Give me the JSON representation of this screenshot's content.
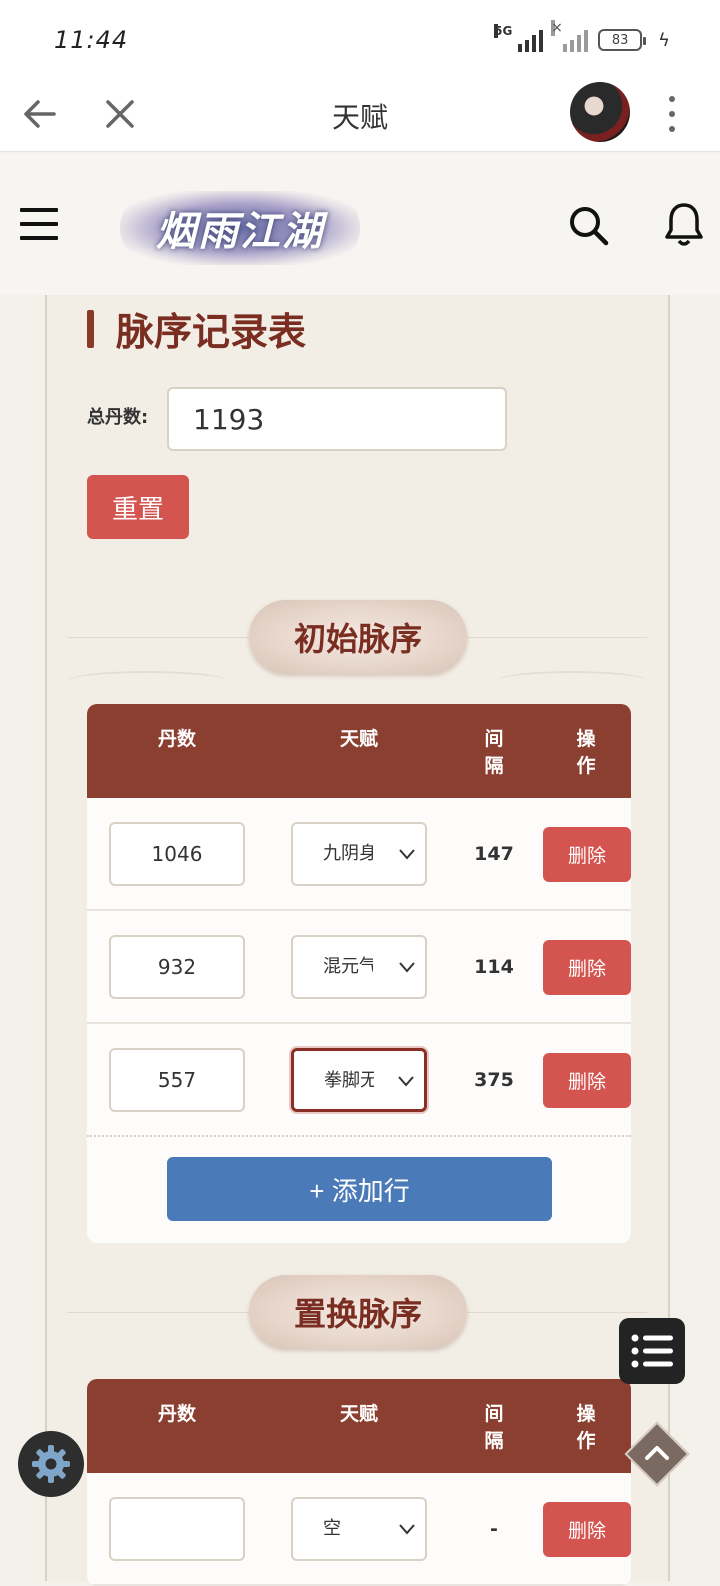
{
  "status_bar": {
    "time": "11:44",
    "network": "5G",
    "battery": "83"
  },
  "title_bar": {
    "title": "天赋"
  },
  "site_header": {
    "logo_text": "烟雨江湖"
  },
  "page": {
    "heading": "脉序记录表",
    "total_label": "总丹数:",
    "total_value": "1193",
    "reset_label": "重置"
  },
  "initial_section": {
    "title": "初始脉序",
    "headers": {
      "dan": "丹数",
      "tianfu": "天赋",
      "gap": "间隔",
      "action": "操作"
    },
    "rows": [
      {
        "dan": "1046",
        "tianfu": "九阴身",
        "gap": "147",
        "delete": "删除"
      },
      {
        "dan": "932",
        "tianfu": "混元气",
        "gap": "114",
        "delete": "删除"
      },
      {
        "dan": "557",
        "tianfu": "拳脚无",
        "gap": "375",
        "delete": "删除"
      }
    ],
    "add_label": "+ 添加行"
  },
  "replace_section": {
    "title": "置换脉序",
    "headers": {
      "dan": "丹数",
      "tianfu": "天赋",
      "gap": "间隔",
      "action": "操作"
    },
    "rows": [
      {
        "dan": "",
        "tianfu": "空",
        "gap": "-",
        "delete": "删除"
      }
    ]
  },
  "icons": {
    "back": "arrow-left-icon",
    "close": "close-icon",
    "more": "more-vertical-icon",
    "menu": "hamburger-menu-icon",
    "search": "search-icon",
    "bell": "bell-icon",
    "list": "list-icon",
    "up": "chevron-up-icon",
    "settings": "gear-icon"
  },
  "colors": {
    "primary_red": "#d45450",
    "header_brown": "#8b3f30",
    "accent_blue": "#4a7ab7",
    "heading_red": "#7a2e22"
  }
}
